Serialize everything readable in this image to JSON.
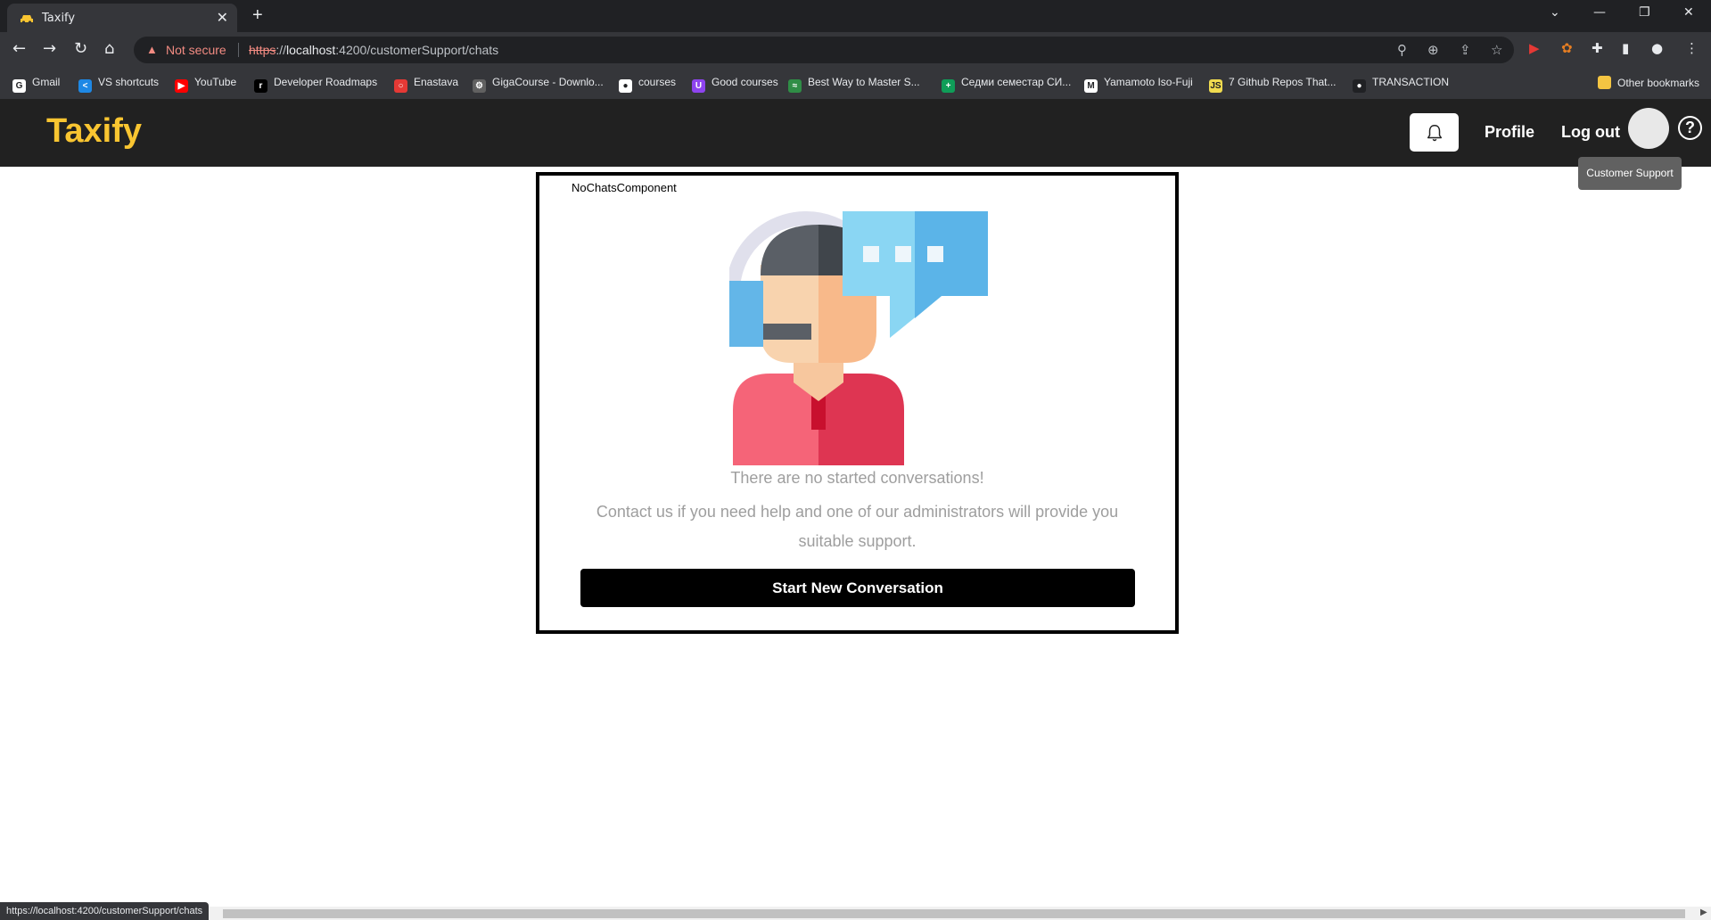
{
  "browser": {
    "tab_title": "Taxify",
    "new_tab": "+",
    "not_secure": "Not secure",
    "url_scheme": "https",
    "url_sep": "://",
    "url_host": "localhost",
    "url_rest": ":4200/customerSupport/chats",
    "status_url": "https://localhost:4200/customerSupport/chats"
  },
  "bookmarks": [
    {
      "label": "Gmail",
      "icon": "google-icon",
      "color": "#ffffff",
      "glyph": "G"
    },
    {
      "label": "VS shortcuts",
      "icon": "vscode-icon",
      "color": "#1e88e5",
      "glyph": "<"
    },
    {
      "label": "YouTube",
      "icon": "youtube-icon",
      "color": "#ff0000",
      "glyph": "▶"
    },
    {
      "label": "Developer Roadmaps",
      "icon": "roadmap-icon",
      "color": "#000000",
      "glyph": "r"
    },
    {
      "label": "Enastava",
      "icon": "enastava-icon",
      "color": "#e53935",
      "glyph": "○"
    },
    {
      "label": "GigaCourse - Downlo...",
      "icon": "gigacourse-icon",
      "color": "#616161",
      "glyph": "⚙"
    },
    {
      "label": "courses",
      "icon": "github-icon",
      "color": "#ffffff",
      "glyph": "●"
    },
    {
      "label": "Good courses",
      "icon": "udemy-icon",
      "color": "#8e44ef",
      "glyph": "U"
    },
    {
      "label": "Best Way to Master S...",
      "icon": "gfg-icon",
      "color": "#2f8d46",
      "glyph": "≈"
    },
    {
      "label": "Седми семестар СИ...",
      "icon": "sheets-icon",
      "color": "#0f9d58",
      "glyph": "+"
    },
    {
      "label": "Yamamoto Iso-Fuji",
      "icon": "medium-icon",
      "color": "#ffffff",
      "glyph": "M"
    },
    {
      "label": "7 Github Repos That...",
      "icon": "js-icon",
      "color": "#f0db4f",
      "glyph": "JS"
    },
    {
      "label": "TRANSACTION",
      "icon": "github-icon",
      "color": "#202124",
      "glyph": "●"
    }
  ],
  "other_bookmarks": "Other bookmarks",
  "app": {
    "logo": "Taxify",
    "nav_profile": "Profile",
    "nav_logout": "Log out",
    "help_glyph": "?",
    "tooltip": "Customer Support"
  },
  "card": {
    "component_name": "NoChatsComponent",
    "title": "There are no started conversations!",
    "text": "Contact us if you need help and one of our administrators will provide you suitable support.",
    "button": "Start New Conversation"
  },
  "colors": {
    "brand": "#f9c531",
    "header_bg": "#212121",
    "button_bg": "#000000",
    "muted_text": "#9e9e9e"
  }
}
